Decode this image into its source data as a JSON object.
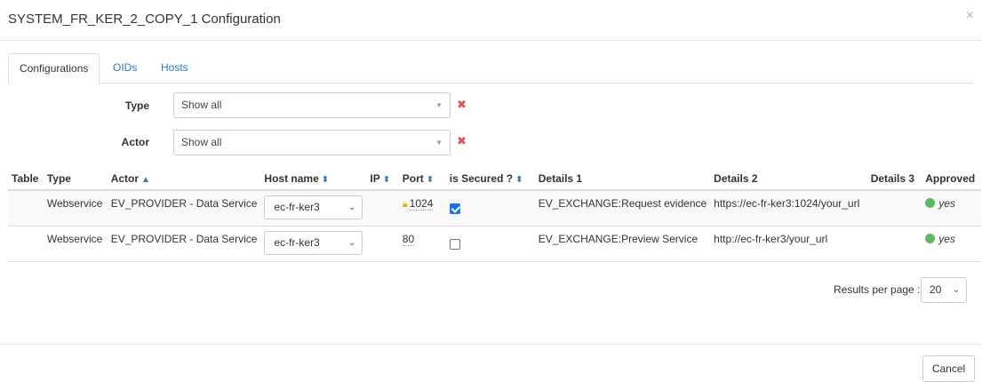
{
  "dialog": {
    "title": "SYSTEM_FR_KER_2_COPY_1 Configuration",
    "close_label": "×"
  },
  "tabs": [
    {
      "label": "Configurations",
      "active": true
    },
    {
      "label": "OIDs",
      "active": false
    },
    {
      "label": "Hosts",
      "active": false
    }
  ],
  "filters": {
    "type": {
      "label": "Type",
      "value": "Show all"
    },
    "actor": {
      "label": "Actor",
      "value": "Show all"
    },
    "clear_label": "✖"
  },
  "table": {
    "headers": {
      "table": "Table",
      "type": "Type",
      "actor": "Actor",
      "host_name": "Host name",
      "ip": "IP",
      "port": "Port",
      "is_secured": "is Secured ?",
      "details1": "Details 1",
      "details2": "Details 2",
      "details3": "Details 3",
      "approved": "Approved"
    },
    "rows": [
      {
        "table": "",
        "type": "Webservice",
        "actor": "EV_PROVIDER - Data Service",
        "host": "ec-fr-ker3",
        "ip": "",
        "port": "1024",
        "secured_lock": true,
        "is_secured": true,
        "details1": "EV_EXCHANGE:Request evidence",
        "details2": "https://ec-fr-ker3:1024/your_url",
        "details3": "",
        "approved": "yes"
      },
      {
        "table": "",
        "type": "Webservice",
        "actor": "EV_PROVIDER - Data Service",
        "host": "ec-fr-ker3",
        "ip": "",
        "port": "80",
        "secured_lock": false,
        "is_secured": false,
        "details1": "EV_EXCHANGE:Preview Service",
        "details2": "http://ec-fr-ker3/your_url",
        "details3": "",
        "approved": "yes"
      }
    ]
  },
  "pagination": {
    "results_per_page_label": "Results per page :",
    "results_per_page_value": "20"
  },
  "footer": {
    "cancel_label": "Cancel"
  },
  "colors": {
    "link": "#337ab7",
    "approved_dot": "#5cb85c",
    "clear_icon": "#d9534f",
    "lock": "#e5b800",
    "checkbox_checked": "#1a73e8"
  }
}
